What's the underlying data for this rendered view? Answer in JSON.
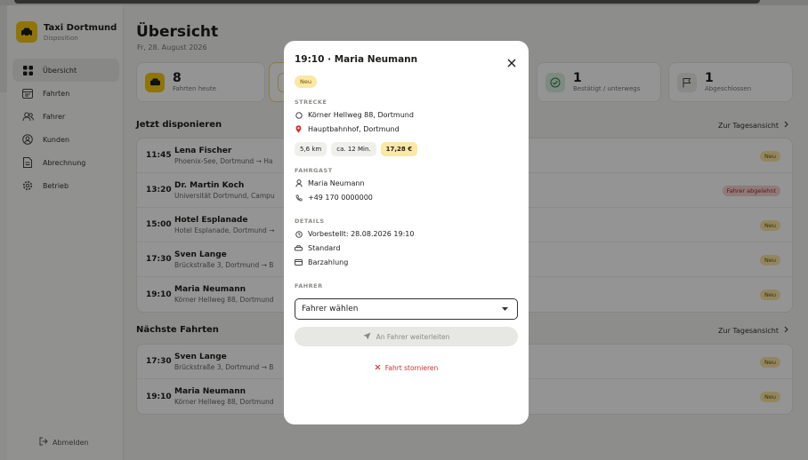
{
  "colors": {
    "accent": "#f6c90e",
    "danger": "#d03030",
    "overlay": "rgba(0,0,0,0.42)"
  },
  "brand": {
    "title": "Taxi Dortmund",
    "subtitle": "Disposition",
    "icon": "taxi-icon"
  },
  "nav": {
    "items": [
      {
        "label": "Übersicht",
        "icon": "grid-icon",
        "active": true
      },
      {
        "label": "Fahrten",
        "icon": "list-icon"
      },
      {
        "label": "Fahrer",
        "icon": "users-icon"
      },
      {
        "label": "Kunden",
        "icon": "user-circle-icon"
      },
      {
        "label": "Abrechnung",
        "icon": "document-icon"
      },
      {
        "label": "Betrieb",
        "icon": "gear-icon"
      }
    ],
    "logout": "Abmelden"
  },
  "header": {
    "title": "Übersicht",
    "date": "Fr, 28. August 2026"
  },
  "stats": [
    {
      "value": "8",
      "label": "Fahrten heute",
      "icon": "taxi-icon"
    },
    {
      "value": "",
      "label": "",
      "icon": ""
    },
    {
      "value": "1",
      "label": "Bestätigt / unterwegs",
      "icon": "check-circle-icon"
    },
    {
      "value": "1",
      "label": "Abgeschlossen",
      "icon": "flag-icon"
    }
  ],
  "dispatch": {
    "title": "Jetzt disponieren",
    "link": "Zur Tagesansicht",
    "rows": [
      {
        "time": "11:45",
        "name": "Lena Fischer",
        "route": "Phoenix-See, Dortmund → Ha",
        "status": "Neu"
      },
      {
        "time": "13:20",
        "name": "Dr. Martin Koch",
        "route": "Universität Dortmund, Campu",
        "status": "Fahrer abgelehnt"
      },
      {
        "time": "15:00",
        "name": "Hotel Esplanade",
        "route": "Hotel Esplanade, Dortmund →",
        "status": "Neu"
      },
      {
        "time": "17:30",
        "name": "Sven Lange",
        "route": "Brückstraße 3, Dortmund → B",
        "status": "Neu"
      },
      {
        "time": "19:10",
        "name": "Maria Neumann",
        "route": "Körner Hellweg 88, Dortmund",
        "status": "Neu"
      }
    ]
  },
  "upcoming": {
    "title": "Nächste Fahrten",
    "link": "Zur Tagesansicht",
    "rows": [
      {
        "time": "17:30",
        "name": "Sven Lange",
        "route": "Brückstraße 3, Dortmund → B",
        "status": "Neu"
      },
      {
        "time": "19:10",
        "name": "Maria Neumann",
        "route": "Körner Hellweg 88, Dortmund",
        "status": "Neu"
      }
    ]
  },
  "modal": {
    "title": "19:10 · Maria Neumann",
    "badge": "Neu",
    "route_label": "STRECKE",
    "pickup": "Körner Hellweg 88, Dortmund",
    "destination": "Hauptbahnhof, Dortmund",
    "distance": "5,6 km",
    "duration": "ca. 12 Min.",
    "price": "17,28 €",
    "passenger_label": "FAHRGAST",
    "passenger_name": "Maria Neumann",
    "passenger_phone": "+49 170 0000000",
    "details_label": "DETAILS",
    "preordered": "Vorbestellt: 28.08.2026 19:10",
    "vehicle": "Standard",
    "payment": "Barzahlung",
    "driver_label": "FAHRER",
    "driver_select": "Fahrer wählen",
    "forward_button": "An Fahrer weiterleiten",
    "cancel_button": "Fahrt stornieren"
  }
}
